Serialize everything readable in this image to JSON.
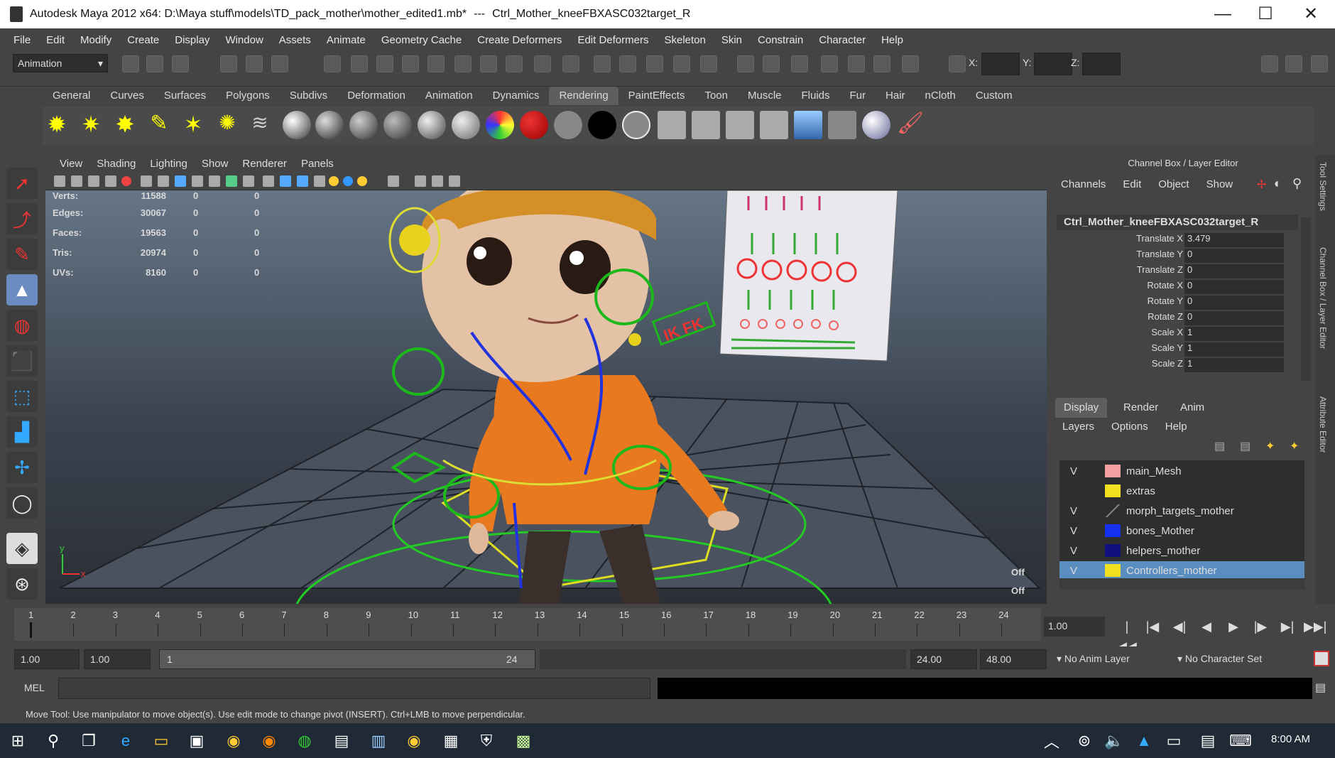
{
  "window": {
    "title": "Autodesk Maya 2012 x64: D:\\Maya stuff\\models\\TD_pack_mother\\mother_edited1.mb*",
    "separator": "---",
    "object": "Ctrl_Mother_kneeFBXASC032target_R",
    "minimize": "—",
    "maximize": "☐",
    "close": "✕"
  },
  "menubar": [
    "File",
    "Edit",
    "Modify",
    "Create",
    "Display",
    "Window",
    "Assets",
    "Animate",
    "Geometry Cache",
    "Create Deformers",
    "Edit Deformers",
    "Skeleton",
    "Skin",
    "Constrain",
    "Character",
    "Help"
  ],
  "statusline": {
    "menuset": "Animation",
    "x_label": "X:",
    "y_label": "Y:",
    "z_label": "Z:"
  },
  "shelf": {
    "tabs": [
      "General",
      "Curves",
      "Surfaces",
      "Polygons",
      "Subdivs",
      "Deformation",
      "Animation",
      "Dynamics",
      "Rendering",
      "PaintEffects",
      "Toon",
      "Muscle",
      "Fluids",
      "Fur",
      "Hair",
      "nCloth",
      "Custom"
    ],
    "active_tab": "Rendering"
  },
  "viewport": {
    "menu": [
      "View",
      "Shading",
      "Lighting",
      "Show",
      "Renderer",
      "Panels"
    ],
    "hud": [
      {
        "label": "Verts:",
        "v1": "11588",
        "v2": "0",
        "v3": "0"
      },
      {
        "label": "Edges:",
        "v1": "30067",
        "v2": "0",
        "v3": "0"
      },
      {
        "label": "Faces:",
        "v1": "19563",
        "v2": "0",
        "v3": "0"
      },
      {
        "label": "Tris:",
        "v1": "20974",
        "v2": "0",
        "v3": "0"
      },
      {
        "label": "UVs:",
        "v1": "8160",
        "v2": "0",
        "v3": "0"
      }
    ],
    "off1": "Off",
    "off2": "Off",
    "ikfk": "IK FK",
    "axis_y": "y",
    "axis_x": "x"
  },
  "channelbox": {
    "header": "Channel Box / Layer Editor",
    "menu": [
      "Channels",
      "Edit",
      "Object",
      "Show"
    ],
    "object": "Ctrl_Mother_kneeFBXASC032target_R",
    "channels": [
      {
        "label": "Translate X",
        "value": "3.479"
      },
      {
        "label": "Translate Y",
        "value": "0"
      },
      {
        "label": "Translate Z",
        "value": "0"
      },
      {
        "label": "Rotate X",
        "value": "0"
      },
      {
        "label": "Rotate Y",
        "value": "0"
      },
      {
        "label": "Rotate Z",
        "value": "0"
      },
      {
        "label": "Scale X",
        "value": "1"
      },
      {
        "label": "Scale Y",
        "value": "1"
      },
      {
        "label": "Scale Z",
        "value": "1"
      }
    ]
  },
  "layereditor": {
    "tabs": [
      "Display",
      "Render",
      "Anim"
    ],
    "active_tab": "Display",
    "menu": [
      "Layers",
      "Options",
      "Help"
    ],
    "layers": [
      {
        "visible": "V",
        "name": "main_Mesh",
        "color": "#f4a0a0"
      },
      {
        "visible": "",
        "name": "extras",
        "color": "#f0e020"
      },
      {
        "visible": "V",
        "name": "morph_targets_mother",
        "color": "#444444"
      },
      {
        "visible": "V",
        "name": "bones_Mother",
        "color": "#1530f0"
      },
      {
        "visible": "V",
        "name": "helpers_mother",
        "color": "#101080"
      },
      {
        "visible": "V",
        "name": "Controllers_mother",
        "color": "#f0e020"
      }
    ],
    "selected_layer": "Controllers_mother"
  },
  "sidetabs": [
    "Tool Settings",
    "Channel Box / Layer Editor",
    "Attribute Editor"
  ],
  "timeline": {
    "frames": [
      "1",
      "2",
      "3",
      "4",
      "5",
      "6",
      "7",
      "8",
      "9",
      "10",
      "11",
      "12",
      "13",
      "14",
      "15",
      "16",
      "17",
      "18",
      "19",
      "20",
      "21",
      "22",
      "23",
      "24"
    ],
    "current_frame": "1.00"
  },
  "playback": {
    "go_start": "|◀◀",
    "step_back_key": "|◀",
    "step_back": "◀|",
    "play_back": "◀",
    "play_fwd": "▶",
    "step_fwd": "|▶",
    "step_fwd_key": "▶|",
    "go_end": "▶▶|"
  },
  "range": {
    "start_time": "1.00",
    "playback_start": "1.00",
    "range_start": "1",
    "range_end": "24",
    "playback_end": "24.00",
    "end_time": "48.00",
    "anim_layer": "No Anim Layer",
    "character_set": "No Character Set"
  },
  "cmdline": {
    "label": "MEL"
  },
  "helpline": "Move Tool: Use manipulator to move object(s). Use edit mode to change pivot (INSERT). Ctrl+LMB to move perpendicular.",
  "taskbar": {
    "clock": "8:00 AM"
  }
}
